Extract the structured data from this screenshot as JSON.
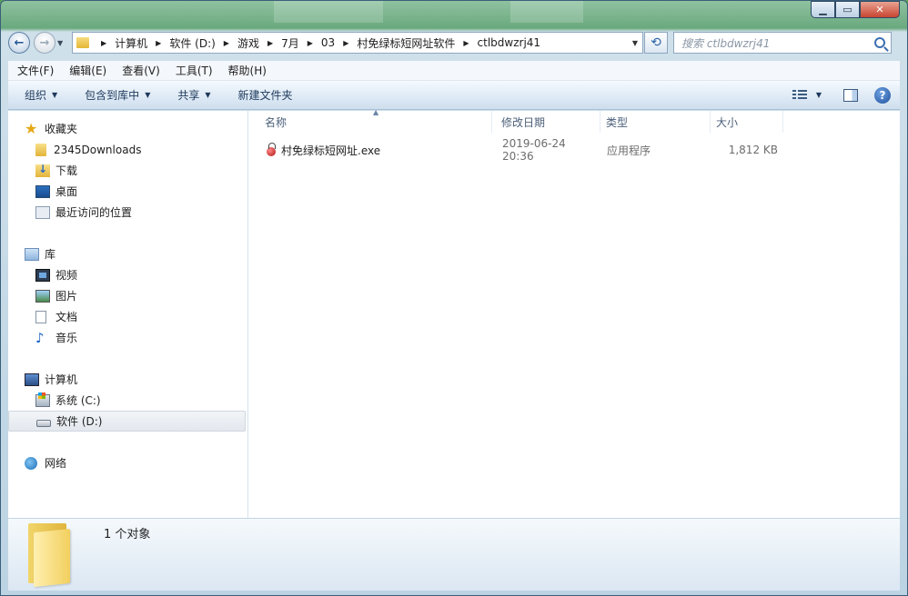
{
  "window": {
    "caption_buttons": [
      "minimize",
      "maximize",
      "close"
    ]
  },
  "navigation": {
    "breadcrumbs": [
      "计算机",
      "软件 (D:)",
      "游戏",
      "7月",
      "03",
      "村免绿标短网址软件",
      "ctlbdwzrj41"
    ],
    "search_placeholder": "搜索 ctlbdwzrj41"
  },
  "menu": [
    "文件(F)",
    "编辑(E)",
    "查看(V)",
    "工具(T)",
    "帮助(H)"
  ],
  "toolbar": {
    "organize": "组织",
    "include_in_library": "包含到库中",
    "share": "共享",
    "new_folder": "新建文件夹"
  },
  "sidebar": {
    "favorites": {
      "label": "收藏夹",
      "items": [
        "2345Downloads",
        "下载",
        "桌面",
        "最近访问的位置"
      ]
    },
    "libraries": {
      "label": "库",
      "items": [
        "视频",
        "图片",
        "文档",
        "音乐"
      ]
    },
    "computer": {
      "label": "计算机",
      "items": [
        "系统 (C:)",
        "软件 (D:)"
      ],
      "selected": "软件 (D:)"
    },
    "network": {
      "label": "网络"
    }
  },
  "columns": {
    "name": "名称",
    "date": "修改日期",
    "type": "类型",
    "size": "大小"
  },
  "files": [
    {
      "name": "村免绿标短网址.exe",
      "date": "2019-06-24 20:36",
      "type": "应用程序",
      "size": "1,812 KB"
    }
  ],
  "details": {
    "count": "1 个对象"
  },
  "colors": {
    "accent": "#2b63a8",
    "selection": "#e3e8ee"
  }
}
